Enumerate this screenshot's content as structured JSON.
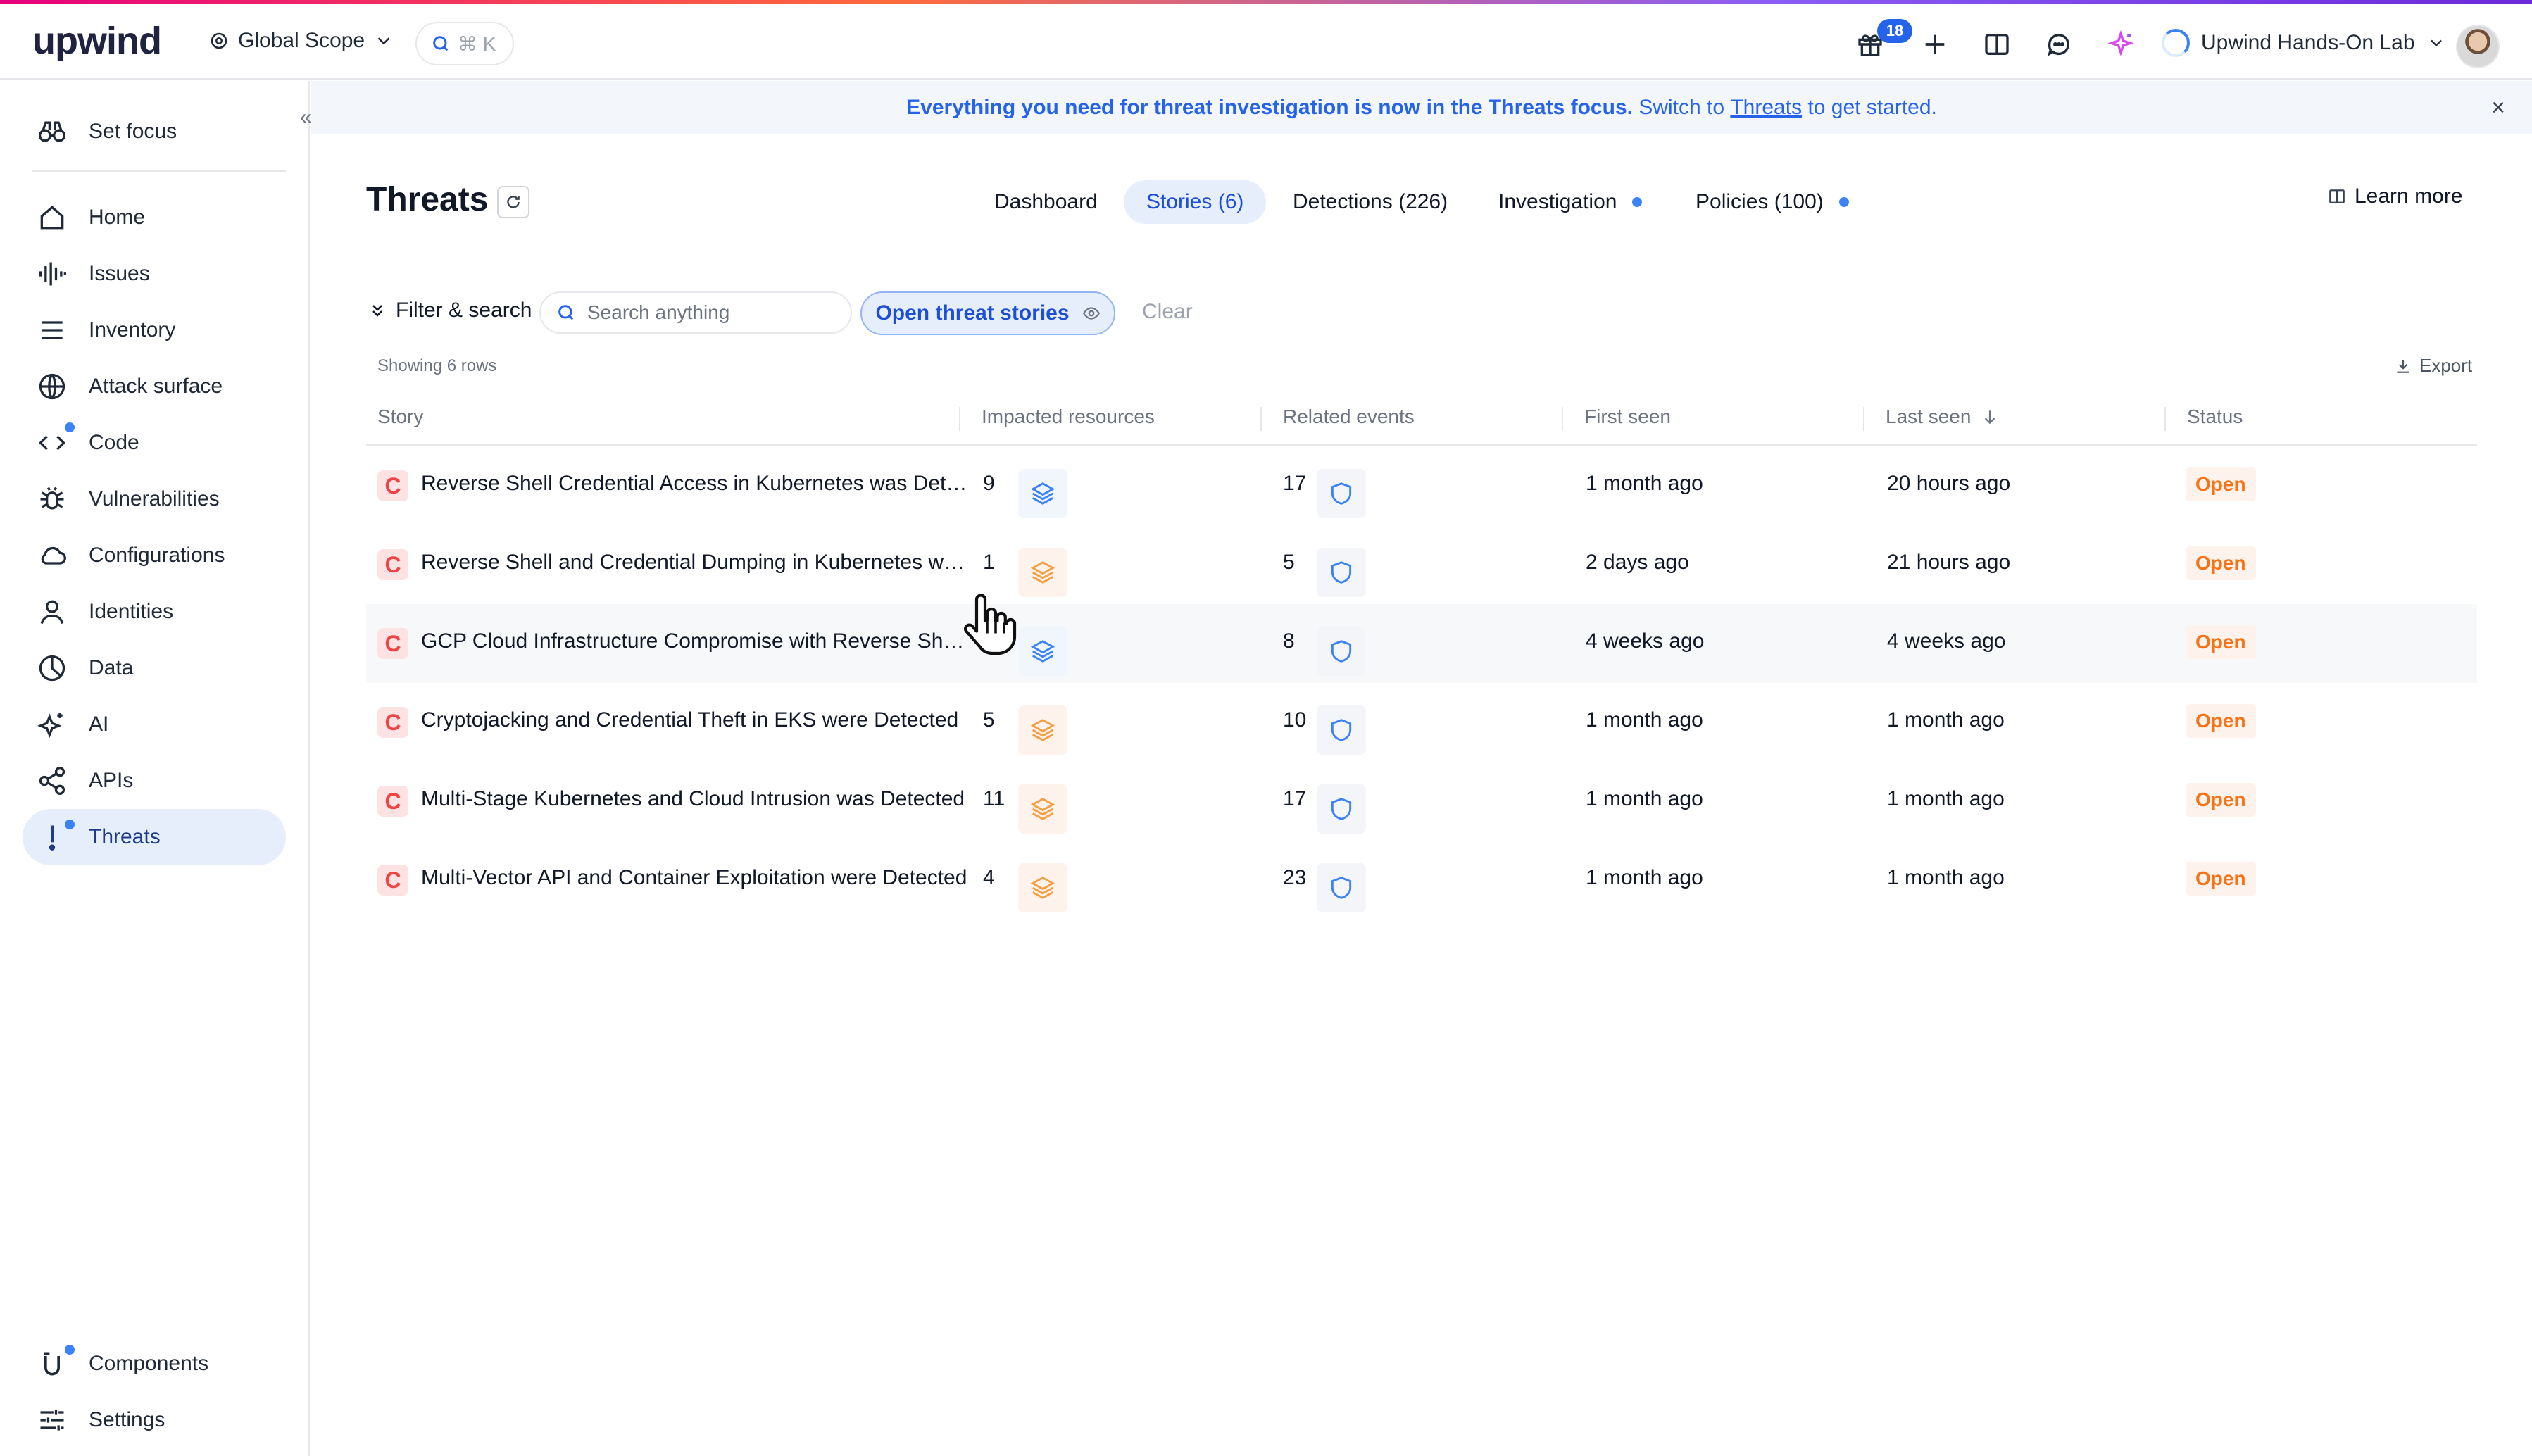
{
  "app": {
    "logo": "upwind",
    "scope_label": "Global Scope",
    "cmdk_label": "⌘ K",
    "gift_badge": "18",
    "org_name": "Upwind Hands-On Lab"
  },
  "sidebar": {
    "set_focus": "Set focus",
    "items": [
      {
        "label": "Home",
        "icon": "home-icon"
      },
      {
        "label": "Issues",
        "icon": "issues-icon"
      },
      {
        "label": "Inventory",
        "icon": "inventory-icon"
      },
      {
        "label": "Attack surface",
        "icon": "globe-icon"
      },
      {
        "label": "Code",
        "icon": "code-icon"
      },
      {
        "label": "Vulnerabilities",
        "icon": "bug-icon"
      },
      {
        "label": "Configurations",
        "icon": "cloud-icon"
      },
      {
        "label": "Identities",
        "icon": "user-icon"
      },
      {
        "label": "Data",
        "icon": "pie-icon"
      },
      {
        "label": "AI",
        "icon": "sparkle-icon"
      },
      {
        "label": "APIs",
        "icon": "share-icon"
      },
      {
        "label": "Threats",
        "icon": "exclamation-icon"
      }
    ],
    "components": "Components",
    "settings": "Settings"
  },
  "banner": {
    "bold": "Everything you need for threat investigation is now in the Threats focus.",
    "pre_link": " Switch to ",
    "link": "Threats",
    "post_link": " to get started."
  },
  "page": {
    "title": "Threats",
    "tabs": [
      {
        "label": "Dashboard"
      },
      {
        "label": "Stories (6)"
      },
      {
        "label": "Detections (226)"
      },
      {
        "label": "Investigation"
      },
      {
        "label": "Policies (100)"
      }
    ],
    "learn_more": "Learn more",
    "filter_label": "Filter & search",
    "search_placeholder": "Search anything",
    "active_filter": "Open threat stories",
    "clear": "Clear",
    "rows_count": "Showing 6 rows",
    "export": "Export"
  },
  "table": {
    "columns": [
      "Story",
      "Impacted resources",
      "Related events",
      "First seen",
      "Last seen",
      "Status"
    ],
    "rows": [
      {
        "severity": "C",
        "story": "Reverse Shell Credential Access in Kubernetes was Dete...",
        "resources": "9",
        "events": "17",
        "first_seen": "1 month ago",
        "last_seen": "20 hours ago",
        "status": "Open"
      },
      {
        "severity": "C",
        "story": "Reverse Shell and Credential Dumping in Kubernetes wer...",
        "resources": "1",
        "events": "5",
        "first_seen": "2 days ago",
        "last_seen": "21 hours ago",
        "status": "Open"
      },
      {
        "severity": "C",
        "story": "GCP Cloud Infrastructure Compromise with Reverse She...",
        "resources": "",
        "events": "8",
        "first_seen": "4 weeks ago",
        "last_seen": "4 weeks ago",
        "status": "Open"
      },
      {
        "severity": "C",
        "story": "Cryptojacking and Credential Theft in EKS were Detected",
        "resources": "5",
        "events": "10",
        "first_seen": "1 month ago",
        "last_seen": "1 month ago",
        "status": "Open"
      },
      {
        "severity": "C",
        "story": "Multi-Stage Kubernetes and Cloud Intrusion was Detected",
        "resources": "11",
        "events": "17",
        "first_seen": "1 month ago",
        "last_seen": "1 month ago",
        "status": "Open"
      },
      {
        "severity": "C",
        "story": "Multi-Vector API and Container Exploitation were Detected",
        "resources": "4",
        "events": "23",
        "first_seen": "1 month ago",
        "last_seen": "1 month ago",
        "status": "Open"
      }
    ]
  },
  "colors": {
    "accent": "#2563eb",
    "critical": "#ef4444",
    "open_status": "#f97316"
  }
}
